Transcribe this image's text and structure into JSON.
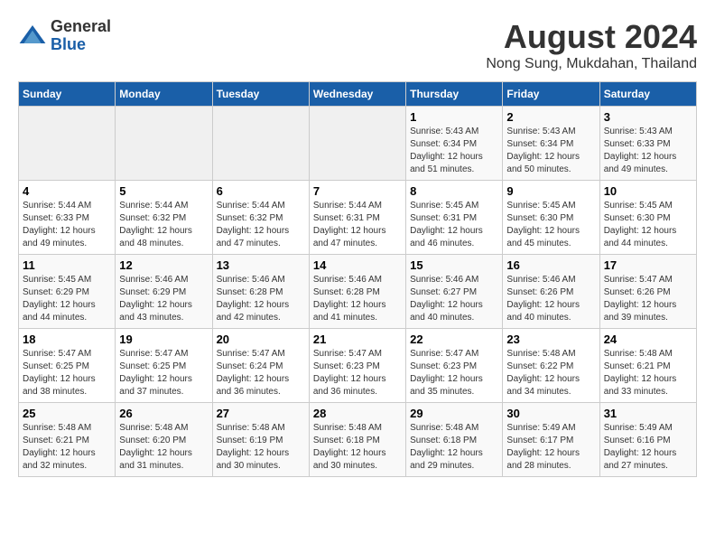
{
  "logo": {
    "line1": "General",
    "line2": "Blue"
  },
  "title": "August 2024",
  "subtitle": "Nong Sung, Mukdahan, Thailand",
  "weekdays": [
    "Sunday",
    "Monday",
    "Tuesday",
    "Wednesday",
    "Thursday",
    "Friday",
    "Saturday"
  ],
  "weeks": [
    [
      {
        "day": "",
        "detail": ""
      },
      {
        "day": "",
        "detail": ""
      },
      {
        "day": "",
        "detail": ""
      },
      {
        "day": "",
        "detail": ""
      },
      {
        "day": "1",
        "detail": "Sunrise: 5:43 AM\nSunset: 6:34 PM\nDaylight: 12 hours\nand 51 minutes."
      },
      {
        "day": "2",
        "detail": "Sunrise: 5:43 AM\nSunset: 6:34 PM\nDaylight: 12 hours\nand 50 minutes."
      },
      {
        "day": "3",
        "detail": "Sunrise: 5:43 AM\nSunset: 6:33 PM\nDaylight: 12 hours\nand 49 minutes."
      }
    ],
    [
      {
        "day": "4",
        "detail": "Sunrise: 5:44 AM\nSunset: 6:33 PM\nDaylight: 12 hours\nand 49 minutes."
      },
      {
        "day": "5",
        "detail": "Sunrise: 5:44 AM\nSunset: 6:32 PM\nDaylight: 12 hours\nand 48 minutes."
      },
      {
        "day": "6",
        "detail": "Sunrise: 5:44 AM\nSunset: 6:32 PM\nDaylight: 12 hours\nand 47 minutes."
      },
      {
        "day": "7",
        "detail": "Sunrise: 5:44 AM\nSunset: 6:31 PM\nDaylight: 12 hours\nand 47 minutes."
      },
      {
        "day": "8",
        "detail": "Sunrise: 5:45 AM\nSunset: 6:31 PM\nDaylight: 12 hours\nand 46 minutes."
      },
      {
        "day": "9",
        "detail": "Sunrise: 5:45 AM\nSunset: 6:30 PM\nDaylight: 12 hours\nand 45 minutes."
      },
      {
        "day": "10",
        "detail": "Sunrise: 5:45 AM\nSunset: 6:30 PM\nDaylight: 12 hours\nand 44 minutes."
      }
    ],
    [
      {
        "day": "11",
        "detail": "Sunrise: 5:45 AM\nSunset: 6:29 PM\nDaylight: 12 hours\nand 44 minutes."
      },
      {
        "day": "12",
        "detail": "Sunrise: 5:46 AM\nSunset: 6:29 PM\nDaylight: 12 hours\nand 43 minutes."
      },
      {
        "day": "13",
        "detail": "Sunrise: 5:46 AM\nSunset: 6:28 PM\nDaylight: 12 hours\nand 42 minutes."
      },
      {
        "day": "14",
        "detail": "Sunrise: 5:46 AM\nSunset: 6:28 PM\nDaylight: 12 hours\nand 41 minutes."
      },
      {
        "day": "15",
        "detail": "Sunrise: 5:46 AM\nSunset: 6:27 PM\nDaylight: 12 hours\nand 40 minutes."
      },
      {
        "day": "16",
        "detail": "Sunrise: 5:46 AM\nSunset: 6:26 PM\nDaylight: 12 hours\nand 40 minutes."
      },
      {
        "day": "17",
        "detail": "Sunrise: 5:47 AM\nSunset: 6:26 PM\nDaylight: 12 hours\nand 39 minutes."
      }
    ],
    [
      {
        "day": "18",
        "detail": "Sunrise: 5:47 AM\nSunset: 6:25 PM\nDaylight: 12 hours\nand 38 minutes."
      },
      {
        "day": "19",
        "detail": "Sunrise: 5:47 AM\nSunset: 6:25 PM\nDaylight: 12 hours\nand 37 minutes."
      },
      {
        "day": "20",
        "detail": "Sunrise: 5:47 AM\nSunset: 6:24 PM\nDaylight: 12 hours\nand 36 minutes."
      },
      {
        "day": "21",
        "detail": "Sunrise: 5:47 AM\nSunset: 6:23 PM\nDaylight: 12 hours\nand 36 minutes."
      },
      {
        "day": "22",
        "detail": "Sunrise: 5:47 AM\nSunset: 6:23 PM\nDaylight: 12 hours\nand 35 minutes."
      },
      {
        "day": "23",
        "detail": "Sunrise: 5:48 AM\nSunset: 6:22 PM\nDaylight: 12 hours\nand 34 minutes."
      },
      {
        "day": "24",
        "detail": "Sunrise: 5:48 AM\nSunset: 6:21 PM\nDaylight: 12 hours\nand 33 minutes."
      }
    ],
    [
      {
        "day": "25",
        "detail": "Sunrise: 5:48 AM\nSunset: 6:21 PM\nDaylight: 12 hours\nand 32 minutes."
      },
      {
        "day": "26",
        "detail": "Sunrise: 5:48 AM\nSunset: 6:20 PM\nDaylight: 12 hours\nand 31 minutes."
      },
      {
        "day": "27",
        "detail": "Sunrise: 5:48 AM\nSunset: 6:19 PM\nDaylight: 12 hours\nand 30 minutes."
      },
      {
        "day": "28",
        "detail": "Sunrise: 5:48 AM\nSunset: 6:18 PM\nDaylight: 12 hours\nand 30 minutes."
      },
      {
        "day": "29",
        "detail": "Sunrise: 5:48 AM\nSunset: 6:18 PM\nDaylight: 12 hours\nand 29 minutes."
      },
      {
        "day": "30",
        "detail": "Sunrise: 5:49 AM\nSunset: 6:17 PM\nDaylight: 12 hours\nand 28 minutes."
      },
      {
        "day": "31",
        "detail": "Sunrise: 5:49 AM\nSunset: 6:16 PM\nDaylight: 12 hours\nand 27 minutes."
      }
    ]
  ]
}
